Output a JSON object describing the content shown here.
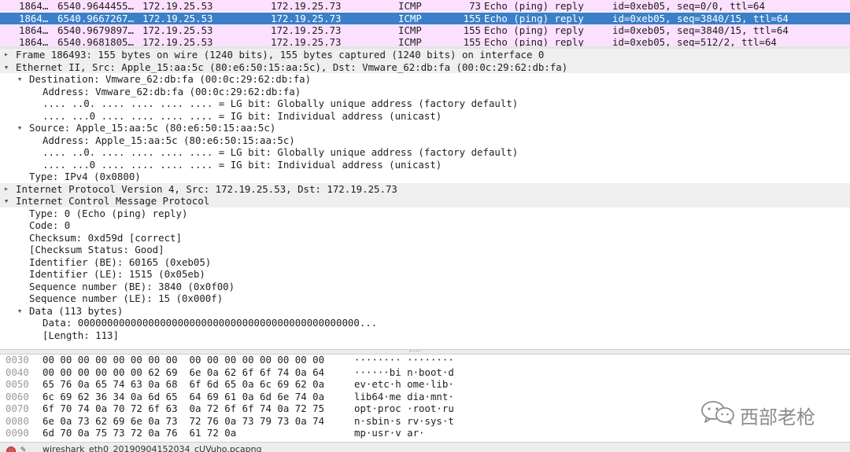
{
  "packet_list": {
    "rows": [
      {
        "no": "1864…",
        "time": "6540.9644455…",
        "src": "172.19.25.53",
        "dst": "172.19.25.73",
        "proto": "ICMP",
        "len": "73",
        "info": "Echo (ping) reply",
        "rest": "id=0xeb05, seq=0/0, ttl=64",
        "selected": false
      },
      {
        "no": "1864…",
        "time": "6540.9667267…",
        "src": "172.19.25.53",
        "dst": "172.19.25.73",
        "proto": "ICMP",
        "len": "155",
        "info": "Echo (ping) reply",
        "rest": "id=0xeb05, seq=3840/15, ttl=64",
        "selected": true
      },
      {
        "no": "1864…",
        "time": "6540.9679897…",
        "src": "172.19.25.53",
        "dst": "172.19.25.73",
        "proto": "ICMP",
        "len": "155",
        "info": "Echo (ping) reply",
        "rest": "id=0xeb05, seq=3840/15, ttl=64",
        "selected": false
      },
      {
        "no": "1864…",
        "time": "6540.9681805…",
        "src": "172.19.25.53",
        "dst": "172.19.25.73",
        "proto": "ICMP",
        "len": "155",
        "info": "Echo (ping) reply",
        "rest": "id=0xeb05, seq=512/2, ttl=64",
        "selected": false
      }
    ]
  },
  "detail_tree": {
    "lines": [
      {
        "text": "Frame 186493: 155 bytes on wire (1240 bits), 155 bytes captured (1240 bits) on interface 0",
        "level": 0,
        "expander": "collapsed"
      },
      {
        "text": "Ethernet II, Src: Apple_15:aa:5c (80:e6:50:15:aa:5c), Dst: Vmware_62:db:fa (00:0c:29:62:db:fa)",
        "level": 0,
        "expander": "expanded"
      },
      {
        "text": "Destination: Vmware_62:db:fa (00:0c:29:62:db:fa)",
        "level": 1,
        "expander": "expanded"
      },
      {
        "text": "Address: Vmware_62:db:fa (00:0c:29:62:db:fa)",
        "level": 2,
        "expander": "none"
      },
      {
        "text": ".... ..0. .... .... .... .... = LG bit: Globally unique address (factory default)",
        "level": 2,
        "expander": "none"
      },
      {
        "text": ".... ...0 .... .... .... .... = IG bit: Individual address (unicast)",
        "level": 2,
        "expander": "none"
      },
      {
        "text": "Source: Apple_15:aa:5c (80:e6:50:15:aa:5c)",
        "level": 1,
        "expander": "expanded"
      },
      {
        "text": "Address: Apple_15:aa:5c (80:e6:50:15:aa:5c)",
        "level": 2,
        "expander": "none"
      },
      {
        "text": ".... ..0. .... .... .... .... = LG bit: Globally unique address (factory default)",
        "level": 2,
        "expander": "none"
      },
      {
        "text": ".... ...0 .... .... .... .... = IG bit: Individual address (unicast)",
        "level": 2,
        "expander": "none"
      },
      {
        "text": "Type: IPv4 (0x0800)",
        "level": 1,
        "expander": "none"
      },
      {
        "text": "Internet Protocol Version 4, Src: 172.19.25.53, Dst: 172.19.25.73",
        "level": 0,
        "expander": "collapsed"
      },
      {
        "text": "Internet Control Message Protocol",
        "level": 0,
        "expander": "expanded"
      },
      {
        "text": "Type: 0 (Echo (ping) reply)",
        "level": 1,
        "expander": "none"
      },
      {
        "text": "Code: 0",
        "level": 1,
        "expander": "none"
      },
      {
        "text": "Checksum: 0xd59d [correct]",
        "level": 1,
        "expander": "none"
      },
      {
        "text": "[Checksum Status: Good]",
        "level": 1,
        "expander": "none"
      },
      {
        "text": "Identifier (BE): 60165 (0xeb05)",
        "level": 1,
        "expander": "none"
      },
      {
        "text": "Identifier (LE): 1515 (0x05eb)",
        "level": 1,
        "expander": "none"
      },
      {
        "text": "Sequence number (BE): 3840 (0x0f00)",
        "level": 1,
        "expander": "none"
      },
      {
        "text": "Sequence number (LE): 15 (0x000f)",
        "level": 1,
        "expander": "none"
      },
      {
        "text": "Data (113 bytes)",
        "level": 1,
        "expander": "expanded"
      },
      {
        "text": "Data: 000000000000000000000000000000000000000000000000...",
        "level": 2,
        "expander": "none"
      },
      {
        "text": "[Length: 113]",
        "level": 2,
        "expander": "none"
      }
    ]
  },
  "bytes_pane": {
    "rows": [
      {
        "offset": "0030",
        "hex": "00 00 00 00 00 00 00 00  00 00 00 00 00 00 00 00",
        "ascii": "········ ········"
      },
      {
        "offset": "0040",
        "hex": "00 00 00 00 00 00 62 69  6e 0a 62 6f 6f 74 0a 64",
        "ascii": "······bi n·boot·d"
      },
      {
        "offset": "0050",
        "hex": "65 76 0a 65 74 63 0a 68  6f 6d 65 0a 6c 69 62 0a",
        "ascii": "ev·etc·h ome·lib·"
      },
      {
        "offset": "0060",
        "hex": "6c 69 62 36 34 0a 6d 65  64 69 61 0a 6d 6e 74 0a",
        "ascii": "lib64·me dia·mnt·"
      },
      {
        "offset": "0070",
        "hex": "6f 70 74 0a 70 72 6f 63  0a 72 6f 6f 74 0a 72 75",
        "ascii": "opt·proc ·root·ru"
      },
      {
        "offset": "0080",
        "hex": "6e 0a 73 62 69 6e 0a 73  72 76 0a 73 79 73 0a 74",
        "ascii": "n·sbin·s rv·sys·t"
      },
      {
        "offset": "0090",
        "hex": "6d 70 0a 75 73 72 0a 76  61 72 0a",
        "ascii": "mp·usr·v ar·"
      }
    ]
  },
  "watermark": {
    "text": "西部老枪",
    "icon": "wechat-icon"
  },
  "status_bar": {
    "filename": "wireshark_eth0_20190904152034_cUVuho.pcapng",
    "capture_led_color": "#d9534f",
    "icons": [
      "capture-status-icon",
      "edit-comment-icon"
    ]
  },
  "colors": {
    "icmp_row": "#fce0ff",
    "selected_row": "#3b80c6",
    "top_level_tree_row": "#efefef",
    "hex_offset": "#9a9a9a"
  }
}
